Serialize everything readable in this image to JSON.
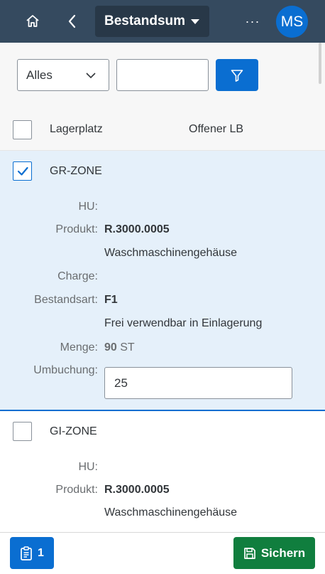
{
  "shellbar": {
    "home_icon": "home-icon",
    "back_icon": "back-icon",
    "title": "Bestandsum",
    "more_label": "···",
    "avatar_initials": "MS"
  },
  "filter": {
    "select_value": "Alles",
    "search_value": "",
    "filter_icon": "filter-icon"
  },
  "table": {
    "columns": [
      "Lagerplatz",
      "Offener LB"
    ]
  },
  "rows": [
    {
      "selected": true,
      "zone": "GR-ZONE",
      "hu_label": "HU:",
      "hu_value": "",
      "product_label": "Produkt:",
      "product_id": "R.3000.0005",
      "product_desc": "Waschmaschinengehäuse",
      "charge_label": "Charge:",
      "stock_type_label": "Bestandsart:",
      "stock_type_code": "F1",
      "stock_type_desc": "Frei verwendbar in Einlagerung",
      "quantity_label": "Menge:",
      "quantity": "90",
      "unit": "ST",
      "transfer_label": "Umbuchung:",
      "transfer_value": "25"
    },
    {
      "selected": false,
      "zone": "GI-ZONE",
      "hu_label": "HU:",
      "product_label": "Produkt:",
      "product_id": "R.3000.0005",
      "product_desc": "Waschmaschinengehäuse"
    }
  ],
  "footer": {
    "clipboard_count": "1",
    "save_label": "Sichern"
  },
  "colors": {
    "shellbar": "#354a5f",
    "accent": "#0a6ed1",
    "save": "#107e3e",
    "selected_row": "#e5f0fa"
  }
}
